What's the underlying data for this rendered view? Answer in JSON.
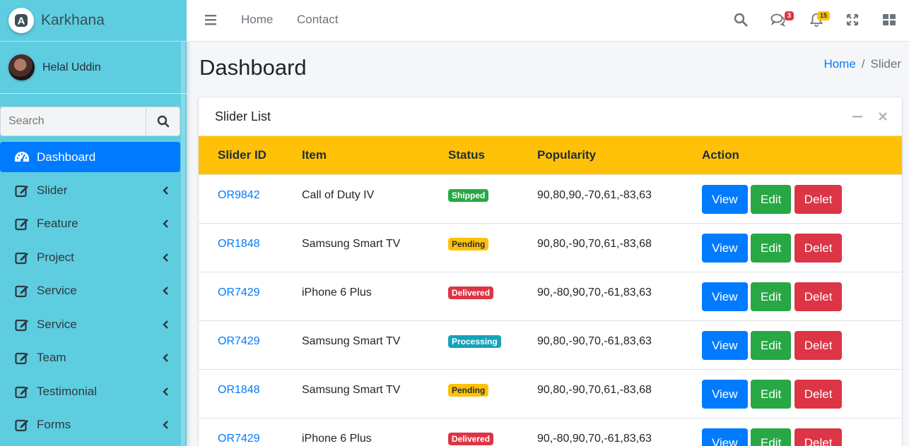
{
  "brand": {
    "name": "Karkhana",
    "logo_letter": "A"
  },
  "user": {
    "name": "Helal Uddin"
  },
  "search": {
    "placeholder": "Search"
  },
  "sidebar": {
    "items": [
      {
        "label": "Dashboard",
        "icon": "tachometer-icon",
        "active": true
      },
      {
        "label": "Slider",
        "icon": "edit-icon"
      },
      {
        "label": "Feature",
        "icon": "edit-icon"
      },
      {
        "label": "Project",
        "icon": "edit-icon"
      },
      {
        "label": "Service",
        "icon": "edit-icon"
      },
      {
        "label": "Service",
        "icon": "edit-icon"
      },
      {
        "label": "Team",
        "icon": "edit-icon"
      },
      {
        "label": "Testimonial",
        "icon": "edit-icon"
      },
      {
        "label": "Forms",
        "icon": "edit-icon"
      }
    ]
  },
  "topnav": {
    "links": [
      "Home",
      "Contact"
    ],
    "messages_badge": "3",
    "notifications_badge": "15"
  },
  "page": {
    "title": "Dashboard"
  },
  "breadcrumb": {
    "home": "Home",
    "separator": "/",
    "current": "Slider"
  },
  "card": {
    "title": "Slider List"
  },
  "table": {
    "headers": [
      "Slider ID",
      "Item",
      "Status",
      "Popularity",
      "Action"
    ],
    "rows": [
      {
        "id": "OR9842",
        "item": "Call of Duty IV",
        "status": "Shipped",
        "popularity": "90,80,90,-70,61,-83,63"
      },
      {
        "id": "OR1848",
        "item": "Samsung Smart TV",
        "status": "Pending",
        "popularity": "90,80,-90,70,61,-83,68"
      },
      {
        "id": "OR7429",
        "item": "iPhone 6 Plus",
        "status": "Delivered",
        "popularity": "90,-80,90,70,-61,83,63"
      },
      {
        "id": "OR7429",
        "item": "Samsung Smart TV",
        "status": "Processing",
        "popularity": "90,80,-90,70,-61,83,63"
      },
      {
        "id": "OR1848",
        "item": "Samsung Smart TV",
        "status": "Pending",
        "popularity": "90,80,-90,70,61,-83,68"
      },
      {
        "id": "OR7429",
        "item": "iPhone 6 Plus",
        "status": "Delivered",
        "popularity": "90,-80,90,70,-61,83,63"
      }
    ],
    "actions": {
      "view": "View",
      "edit": "Edit",
      "delete": "Delet"
    }
  },
  "colors": {
    "sidebar": "#5fcde0",
    "primary": "#007bff",
    "table_header": "#ffc107",
    "shipped": "#28a745",
    "pending": "#ffc107",
    "delivered": "#dc3545",
    "processing": "#17a2b8"
  }
}
